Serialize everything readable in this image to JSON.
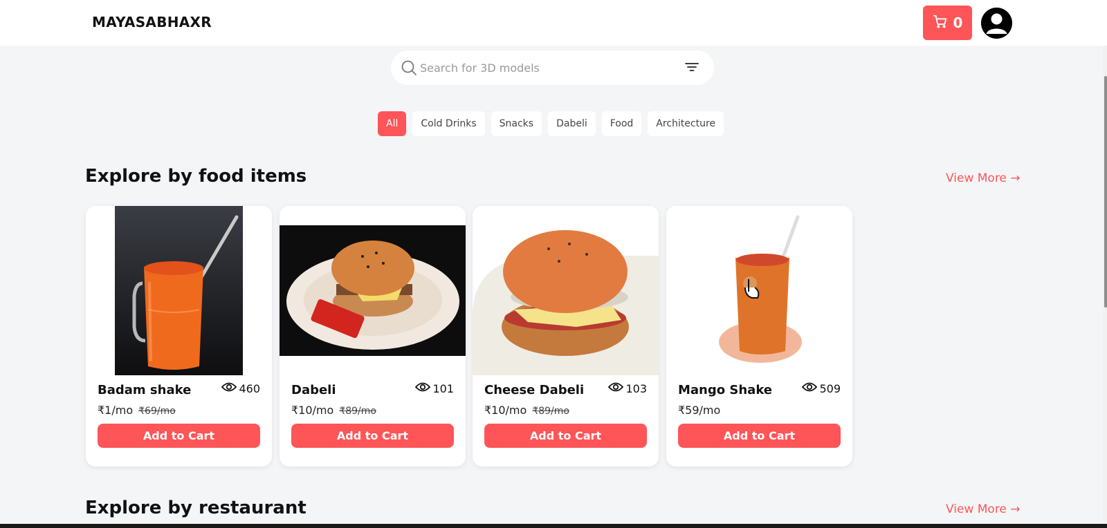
{
  "header": {
    "brand": "MAYASABHAXR",
    "cart_count": "0",
    "icons": {
      "cart": "cart-icon",
      "avatar": "user-avatar-icon"
    }
  },
  "search": {
    "placeholder": "Search for 3D models",
    "value": "",
    "icons": {
      "search": "search-icon",
      "filter": "filter-icon"
    }
  },
  "categories": [
    {
      "label": "All",
      "active": true
    },
    {
      "label": "Cold Drinks",
      "active": false
    },
    {
      "label": "Snacks",
      "active": false
    },
    {
      "label": "Dabeli",
      "active": false
    },
    {
      "label": "Food",
      "active": false
    },
    {
      "label": "Architecture",
      "active": false
    }
  ],
  "sections": [
    {
      "title": "Explore by food items",
      "view_more": "View More →"
    },
    {
      "title": "Explore by restaurant",
      "view_more": "View More →"
    }
  ],
  "products": [
    {
      "name": "Badam shake",
      "views": "460",
      "price": "₹1/mo",
      "old_price": "₹69/mo",
      "button": "Add to Cart"
    },
    {
      "name": "Dabeli",
      "views": "101",
      "price": "₹10/mo",
      "old_price": "₹89/mo",
      "button": "Add to Cart"
    },
    {
      "name": "Cheese Dabeli",
      "views": "103",
      "price": "₹10/mo",
      "old_price": "₹89/mo",
      "button": "Add to Cart"
    },
    {
      "name": "Mango Shake",
      "views": "509",
      "price": "₹59/mo",
      "old_price": "",
      "button": "Add to Cart"
    }
  ],
  "colors": {
    "accent": "#fd5558",
    "background": "#f4f5f7"
  }
}
